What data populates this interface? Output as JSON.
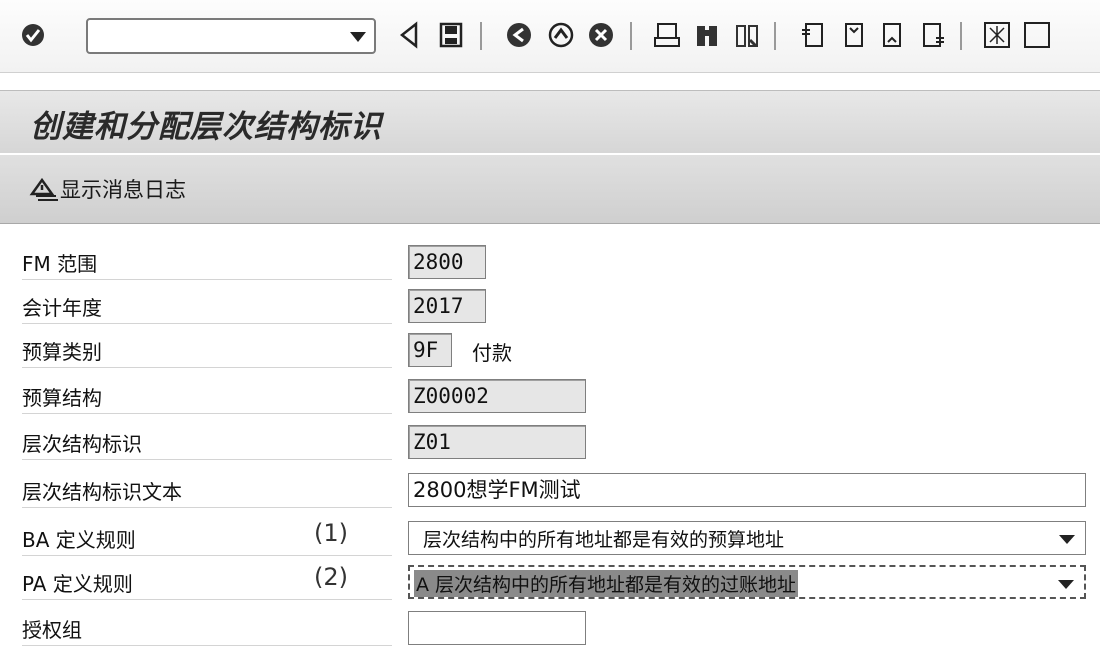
{
  "toolbar": {
    "command_value": "",
    "icons": [
      "enter-icon",
      "back-icon",
      "save-icon",
      "exit-icon",
      "cancel-icon",
      "print-icon",
      "find-icon",
      "find-next-icon",
      "first-page-icon",
      "previous-page-icon",
      "next-page-icon",
      "last-page-icon",
      "layout-icon"
    ]
  },
  "title": "创建和分配层次结构标识",
  "app_toolbar": {
    "show_log_label": "显示消息日志"
  },
  "form": {
    "fm_area": {
      "label": "FM 范围",
      "value": "2800"
    },
    "fiscal_year": {
      "label": "会计年度",
      "value": "2017"
    },
    "budget_category": {
      "label": "预算类别",
      "value": "9F",
      "text": "付款"
    },
    "budget_structure": {
      "label": "预算结构",
      "value": "Z00002"
    },
    "hierarchy_id": {
      "label": "层次结构标识",
      "value": "Z01"
    },
    "hierarchy_text": {
      "label": "层次结构标识文本",
      "value": "2800想学FM测试"
    },
    "ba_rule": {
      "label": "BA 定义规则",
      "note": "(1)",
      "value": "层次结构中的所有地址都是有效的预算地址"
    },
    "pa_rule": {
      "label": "PA 定义规则",
      "note": "(2)",
      "value": "A 层次结构中的所有地址都是有效的过账地址"
    },
    "auth_group": {
      "label": "授权组",
      "value": ""
    }
  }
}
